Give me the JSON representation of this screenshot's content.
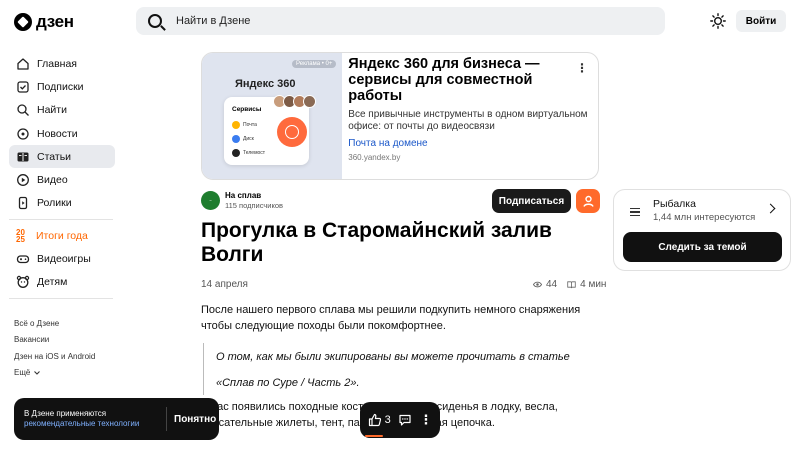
{
  "header": {
    "logo_text": "дзен",
    "search_placeholder": "Найти в Дзене",
    "login_label": "Войти"
  },
  "sidebar": {
    "items": [
      {
        "label": "Главная",
        "icon": "home-icon"
      },
      {
        "label": "Подписки",
        "icon": "subscriptions-icon"
      },
      {
        "label": "Найти",
        "icon": "search-icon"
      },
      {
        "label": "Новости",
        "icon": "news-icon"
      },
      {
        "label": "Статьи",
        "icon": "articles-icon",
        "active": true
      },
      {
        "label": "Видео",
        "icon": "video-icon"
      },
      {
        "label": "Ролики",
        "icon": "clips-icon"
      }
    ],
    "promo": {
      "badge_top": "20",
      "badge_bottom": "25",
      "label": "Итоги года"
    },
    "items2": [
      {
        "label": "Видеоигры",
        "icon": "gamepad-icon"
      },
      {
        "label": "Детям",
        "icon": "kids-icon"
      }
    ],
    "footer": [
      "Всё о Дзене",
      "Вакансии",
      "Дзен на iOS и Android",
      "Ещё"
    ]
  },
  "ad": {
    "badge": "Реклама • 0+",
    "brand": "Яндекс 360",
    "card_title": "Сервисы",
    "card_rows": [
      "Почта",
      "Диск",
      "Телемост"
    ],
    "title": "Яндекс 360 для бизнеса — сервисы для совместной работы",
    "description": "Все привычные инструменты в одном виртуальном офисе: от почты до видеосвязи",
    "link": "Почта на домене",
    "domain": "360.yandex.by"
  },
  "channel": {
    "name": "На сплав",
    "subscribers": "115 подписчиков",
    "subscribe_label": "Подписаться"
  },
  "article": {
    "title": "Прогулка в Старомайнский залив Волги",
    "date": "14 апреля",
    "views": "44",
    "read_time": "4 мин",
    "p1": "После нашего первого сплава мы решили подкупить немного снаряжения чтобы следующие походы были покомфортнее.",
    "quote1": "О том, как мы были экипированы вы можете прочитать в статье",
    "quote2": "«Сплав по Суре / Часть 2».",
    "p2a": "У нас появились походные костюмы «Горка», сиденья в лодку, весла,",
    "p2b": "спасательные жилеты, тент, парус и нарукавная цепочка."
  },
  "cookie": {
    "text": "В Дзене применяются",
    "link": "рекомендательные технологии",
    "ok_label": "Понятно"
  },
  "actions": {
    "likes": "3"
  },
  "topic": {
    "name": "Рыбалка",
    "count": "1,44 млн интересуются",
    "follow_label": "Следить за темой"
  },
  "colors": {
    "accent": "#ff6a2b",
    "link": "#1a57c9",
    "dark": "#111111"
  }
}
